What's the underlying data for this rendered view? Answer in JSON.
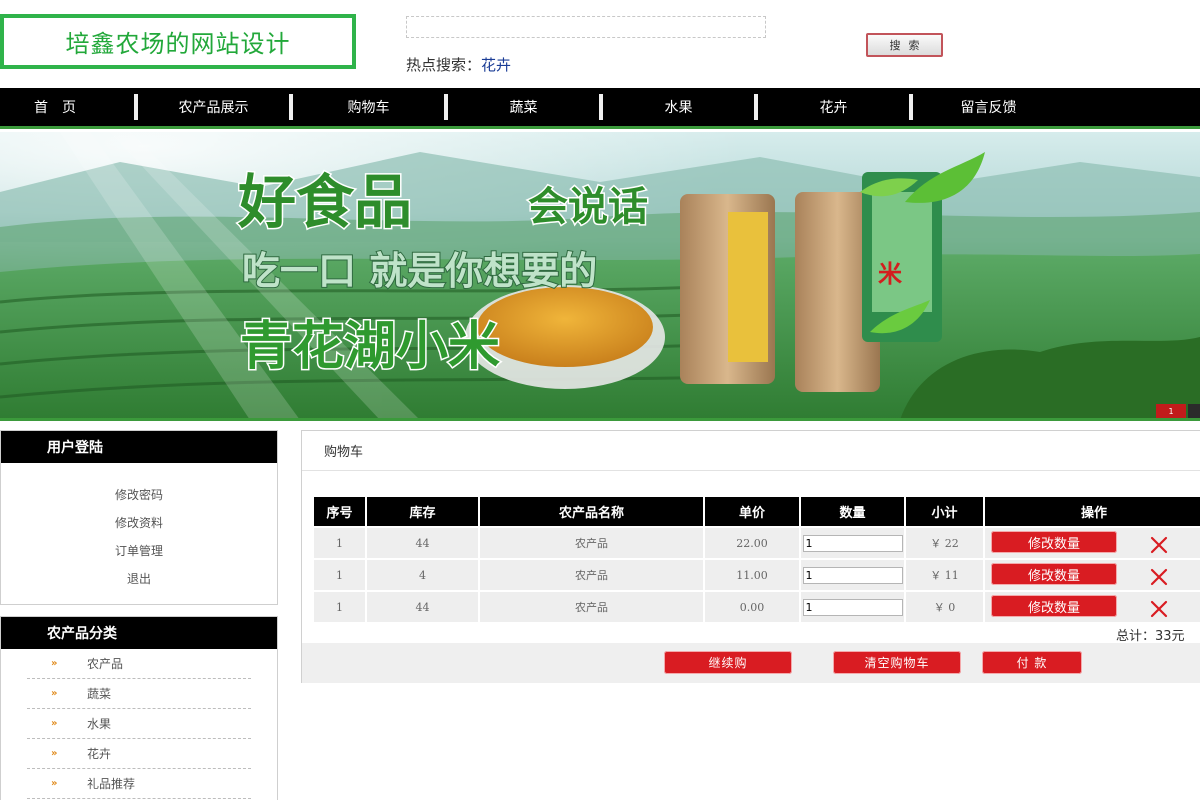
{
  "header": {
    "logo_text": "培鑫农场的网站设计",
    "search_placeholder": "",
    "hot_search_label": "热点搜索：",
    "hot_search_link": "花卉",
    "search_button": "搜索"
  },
  "nav": {
    "items": [
      "首页",
      "农产品展示",
      "购物车",
      "蔬菜",
      "水果",
      "花卉",
      "留言反馈"
    ]
  },
  "banner": {
    "slide_indicator": "1",
    "accent_color": "#3b9a3b"
  },
  "sidebar": {
    "user_title": "用户登陆",
    "user_links": [
      "修改密码",
      "修改资料",
      "订单管理",
      "退出"
    ],
    "category_title": "农产品分类",
    "categories": [
      "农产品",
      "蔬菜",
      "水果",
      "花卉",
      "礼品推荐"
    ]
  },
  "cart": {
    "title": "购物车",
    "columns": [
      "序号",
      "库存",
      "农产品名称",
      "单价",
      "数量",
      "小计",
      "操作"
    ],
    "rows": [
      {
        "index": "1",
        "stock": "44",
        "name": "农产品",
        "price": "22.00",
        "qty": "1",
        "subtotal": "￥ 22",
        "action": "修改数量"
      },
      {
        "index": "1",
        "stock": "4",
        "name": "农产品",
        "price": "11.00",
        "qty": "1",
        "subtotal": "￥ 11",
        "action": "修改数量"
      },
      {
        "index": "1",
        "stock": "44",
        "name": "农产品",
        "price": "0.00",
        "qty": "1",
        "subtotal": "￥ 0",
        "action": "修改数量"
      }
    ],
    "total": "总计：33元",
    "buttons": {
      "continue": "继续购",
      "clear": "清空购物车",
      "pay": "付 款"
    },
    "button_color": "#d91c22"
  }
}
